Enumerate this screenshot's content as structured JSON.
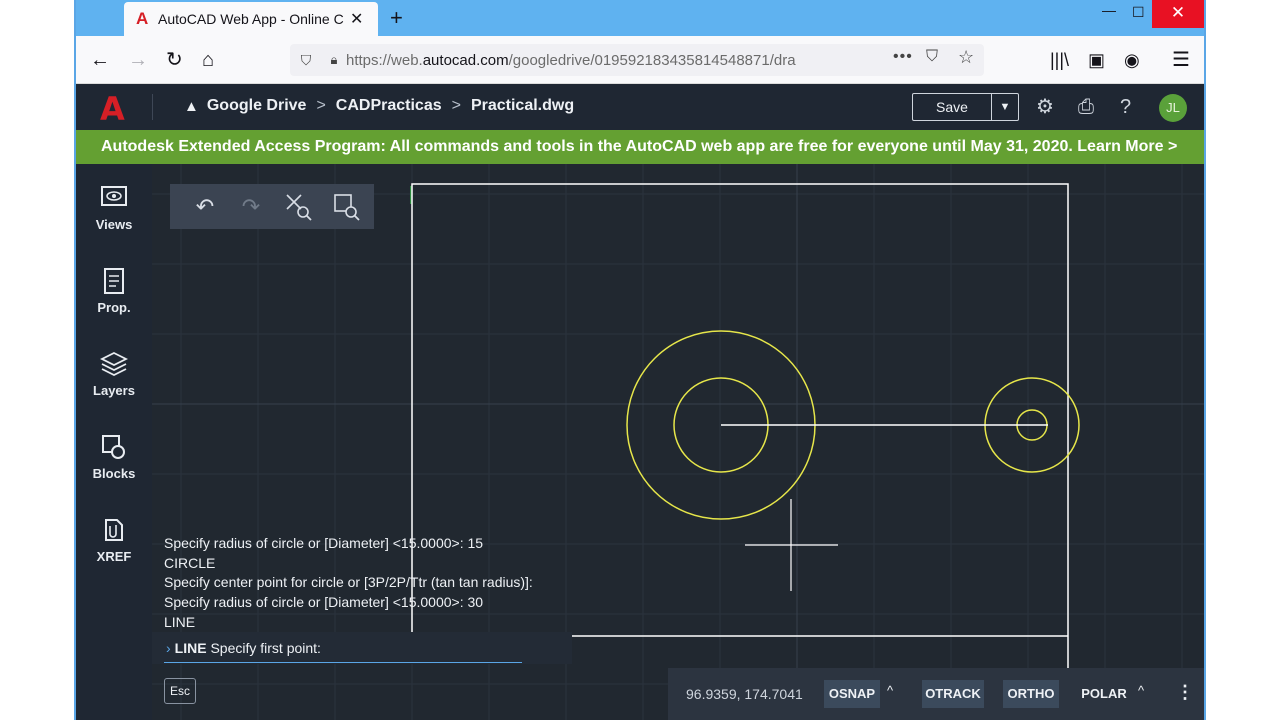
{
  "browser": {
    "tab_title": "AutoCAD Web App - Online C",
    "tab_favicon": "A",
    "url_scheme": "https://web.",
    "url_domain": "autocad.com",
    "url_path": "/googledrive/019592183435814548871/dra",
    "icons": [
      "back-arrow-icon",
      "forward-arrow-icon",
      "reload-icon",
      "home-icon",
      "shield-icon",
      "lock-icon",
      "more-icon",
      "pocket-icon",
      "star-icon",
      "library-icon",
      "sidebar-icon",
      "account-icon",
      "menu-icon"
    ]
  },
  "header": {
    "logo": "A",
    "breadcrumbs": [
      "Google Drive",
      "CADPracticas",
      "Practical.dwg"
    ],
    "save_label": "Save",
    "avatar_initials": "JL"
  },
  "banner": {
    "text": "Autodesk Extended Access Program: All commands and tools in the AutoCAD web app are free for everyone until May 31, 2020.",
    "link": "Learn More >"
  },
  "left_tools": [
    {
      "label": "Views",
      "icon": "views-icon"
    },
    {
      "label": "Prop.",
      "icon": "properties-icon"
    },
    {
      "label": "Layers",
      "icon": "layers-icon"
    },
    {
      "label": "Blocks",
      "icon": "blocks-icon"
    },
    {
      "label": "XREF",
      "icon": "xref-icon"
    }
  ],
  "command": {
    "history": [
      "Specify radius of circle or [Diameter] <15.0000>: 15",
      "CIRCLE",
      "Specify center point for circle or [3P/2P/Ttr (tan tan radius)]:",
      "Specify radius of circle or [Diameter] <15.0000>: 30",
      "LINE"
    ],
    "current_cmd": "LINE",
    "current_prompt": "Specify first point:",
    "esc_label": "Esc"
  },
  "status": {
    "coords": "96.9359, 174.7041",
    "osnap": "OSNAP",
    "otrack": "OTRACK",
    "ortho": "ORTHO",
    "polar": "POLAR"
  },
  "colors": {
    "accent_blue": "#5aa6e6",
    "brand_red": "#d61f26",
    "banner_green": "#64a032",
    "geometry_yellow": "#e6e64a",
    "geometry_white": "#ffffff"
  }
}
